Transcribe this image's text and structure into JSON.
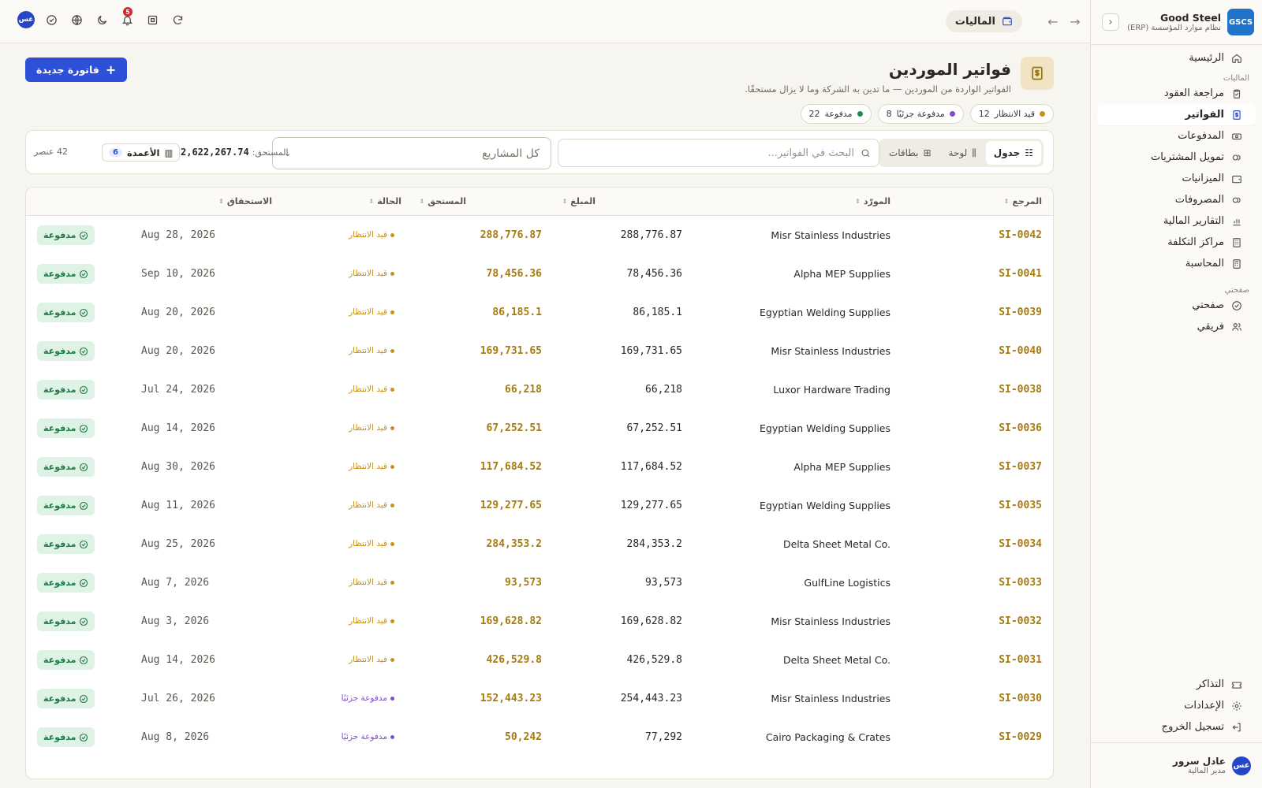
{
  "brand": {
    "logo": "GSCS",
    "name": "Good Steel",
    "subtitle": "نظام موارد المؤسسة (ERP)"
  },
  "nav": {
    "home": "الرئيسية",
    "finance_section": "الماليات",
    "finance_items": [
      {
        "label": "مراجعة العقود",
        "icon": "clipboard-check-icon"
      },
      {
        "label": "الفواتير",
        "icon": "invoice-icon",
        "active": true
      },
      {
        "label": "المدفوعات",
        "icon": "banknote-icon"
      },
      {
        "label": "تمويل المشتريات",
        "icon": "coins-icon"
      },
      {
        "label": "الميزانيات",
        "icon": "wallet-icon"
      },
      {
        "label": "المصروفات",
        "icon": "receipt-icon"
      },
      {
        "label": "التقارير المالية",
        "icon": "bar-chart-icon"
      },
      {
        "label": "مراكز التكلفة",
        "icon": "building-icon"
      },
      {
        "label": "المحاسبة",
        "icon": "calculator-icon"
      }
    ],
    "my_section": "صفحتي",
    "my_items": [
      {
        "label": "صفحتي",
        "icon": "check-circle-icon"
      },
      {
        "label": "فريقي",
        "icon": "users-icon"
      }
    ],
    "bottom_items": [
      {
        "label": "التذاكر",
        "icon": "ticket-icon"
      },
      {
        "label": "الإعدادات",
        "icon": "gear-icon"
      },
      {
        "label": "تسجيل الخروج",
        "icon": "logout-icon"
      }
    ]
  },
  "user": {
    "initials": "عس",
    "name": "عادل سرور",
    "role": "مدير المالية"
  },
  "topbar": {
    "breadcrumb": "الماليات",
    "notifications": "5",
    "avatar": "عس"
  },
  "header": {
    "title": "فواتير الموردين",
    "subtitle": "الفواتير الواردة من الموردين — ما تدين به الشركة وما لا يزال مستحقًا.",
    "new_button": "فاتورة جديدة"
  },
  "status_pills": [
    {
      "label": "قيد الانتظار",
      "count": "12",
      "color": "#c8921a"
    },
    {
      "label": "مدفوعة جزئيًا",
      "count": "8",
      "color": "#7d4fc8"
    },
    {
      "label": "مدفوعة",
      "count": "22",
      "color": "#1f8a50"
    }
  ],
  "filters": {
    "views": [
      "جدول",
      "لوحة",
      "بطاقات"
    ],
    "search_placeholder": "البحث في الفواتير...",
    "project": "كل المشاريع",
    "due_label": "المستحق:",
    "due_total": "2,622,267.74",
    "columns_label": "الأعمدة",
    "columns_count": "6",
    "items_count": "42 عنصر"
  },
  "table": {
    "headers": {
      "ref": "المرجع",
      "vendor": "المورّد",
      "amount": "المبلغ",
      "due": "المستحق",
      "status": "الحالة",
      "due_date": "الاستحقاق"
    },
    "paid_badge": "مدفوعة",
    "rows": [
      {
        "ref": "SI-0042",
        "vendor": "Misr Stainless Industries",
        "amount": "288,776.87",
        "due": "288,776.87",
        "status": "قيد الانتظار",
        "date": "Aug 28, 2026"
      },
      {
        "ref": "SI-0041",
        "vendor": "Alpha MEP Supplies",
        "amount": "78,456.36",
        "due": "78,456.36",
        "status": "قيد الانتظار",
        "date": "Sep 10, 2026"
      },
      {
        "ref": "SI-0039",
        "vendor": "Egyptian Welding Supplies",
        "amount": "86,185.1",
        "due": "86,185.1",
        "status": "قيد الانتظار",
        "date": "Aug 20, 2026"
      },
      {
        "ref": "SI-0040",
        "vendor": "Misr Stainless Industries",
        "amount": "169,731.65",
        "due": "169,731.65",
        "status": "قيد الانتظار",
        "date": "Aug 20, 2026"
      },
      {
        "ref": "SI-0038",
        "vendor": "Luxor Hardware Trading",
        "amount": "66,218",
        "due": "66,218",
        "status": "قيد الانتظار",
        "date": "Jul 24, 2026"
      },
      {
        "ref": "SI-0036",
        "vendor": "Egyptian Welding Supplies",
        "amount": "67,252.51",
        "due": "67,252.51",
        "status": "قيد الانتظار",
        "date": "Aug 14, 2026"
      },
      {
        "ref": "SI-0037",
        "vendor": "Alpha MEP Supplies",
        "amount": "117,684.52",
        "due": "117,684.52",
        "status": "قيد الانتظار",
        "date": "Aug 30, 2026"
      },
      {
        "ref": "SI-0035",
        "vendor": "Egyptian Welding Supplies",
        "amount": "129,277.65",
        "due": "129,277.65",
        "status": "قيد الانتظار",
        "date": "Aug 11, 2026"
      },
      {
        "ref": "SI-0034",
        "vendor": "Delta Sheet Metal Co.",
        "amount": "284,353.2",
        "due": "284,353.2",
        "status": "قيد الانتظار",
        "date": "Aug 25, 2026"
      },
      {
        "ref": "SI-0033",
        "vendor": "GulfLine Logistics",
        "amount": "93,573",
        "due": "93,573",
        "status": "قيد الانتظار",
        "date": "Aug 7, 2026"
      },
      {
        "ref": "SI-0032",
        "vendor": "Misr Stainless Industries",
        "amount": "169,628.82",
        "due": "169,628.82",
        "status": "قيد الانتظار",
        "date": "Aug 3, 2026"
      },
      {
        "ref": "SI-0031",
        "vendor": "Delta Sheet Metal Co.",
        "amount": "426,529.8",
        "due": "426,529.8",
        "status": "قيد الانتظار",
        "date": "Aug 14, 2026"
      },
      {
        "ref": "SI-0030",
        "vendor": "Misr Stainless Industries",
        "amount": "254,443.23",
        "due": "152,443.23",
        "status": "مدفوعة جزئيًا",
        "date": "Jul 26, 2026"
      },
      {
        "ref": "SI-0029",
        "vendor": "Cairo Packaging & Crates",
        "amount": "77,292",
        "due": "50,242",
        "status": "مدفوعة جزئيًا",
        "date": "Aug 8, 2026"
      }
    ]
  },
  "colors": {
    "accent": "#2e4fd8",
    "pending": "#c8921a",
    "partial": "#7d4fc8",
    "paid": "#1f7a46",
    "ref": "#a77b10"
  }
}
